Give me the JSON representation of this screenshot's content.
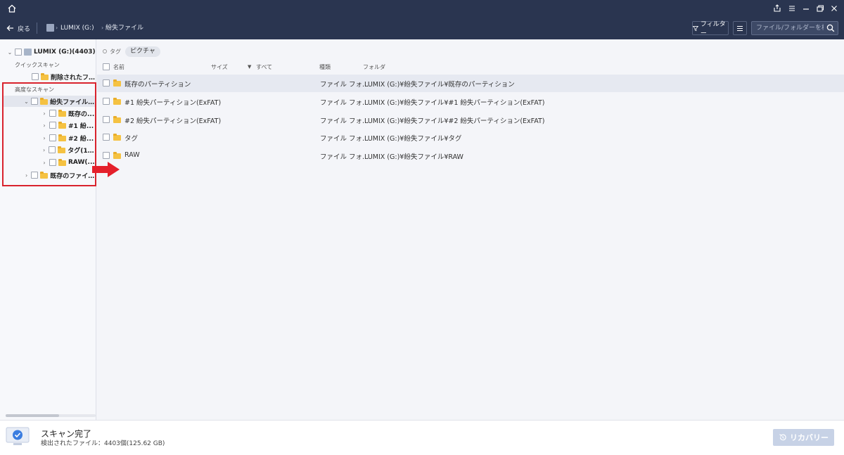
{
  "nav": {
    "back_label": "戻る",
    "crumbs": [
      "LUMIX (G:)",
      "紛失ファイル"
    ],
    "filter_label": "フィルター",
    "search_placeholder": "ファイル/フォルダーを検索"
  },
  "sidebar": {
    "root_label": "LUMIX (G:)(4403)",
    "quick_scan_label": "クイックスキャン",
    "deleted_label": "削除されたファ...",
    "advanced_scan_label": "高度なスキャン",
    "lost_label": "紛失ファイル(4...",
    "children": [
      "既存の...",
      "#1 紛...",
      "#2 紛...",
      "タグ(14...",
      "RAW(..."
    ],
    "existing_label": "既存のファイル..."
  },
  "main": {
    "tag_label": "タグ",
    "tag_chip": "ピクチャ",
    "columns": {
      "name": "名前",
      "size": "サイズ",
      "all": "すべて",
      "type": "種類",
      "folder": "フォルダ"
    },
    "rows": [
      {
        "name": "既存のパーティション",
        "type": "ファイル フォ...",
        "folder": "LUMIX (G:)¥紛失ファイル¥既存のパーティション"
      },
      {
        "name": "#1 紛失パーティション(ExFAT)",
        "type": "ファイル フォ...",
        "folder": "LUMIX (G:)¥紛失ファイル¥#1 紛失パーティション(ExFAT)"
      },
      {
        "name": "#2 紛失パーティション(ExFAT)",
        "type": "ファイル フォ...",
        "folder": "LUMIX (G:)¥紛失ファイル¥#2 紛失パーティション(ExFAT)"
      },
      {
        "name": "タグ",
        "type": "ファイル フォ...",
        "folder": "LUMIX (G:)¥紛失ファイル¥タグ"
      },
      {
        "name": "RAW",
        "type": "ファイル フォ...",
        "folder": "LUMIX (G:)¥紛失ファイル¥RAW"
      }
    ]
  },
  "status": {
    "title": "スキャン完了",
    "subtitle": "検出されたファイル：4403個(125.62 GB)",
    "recover_label": "リカバリー"
  },
  "colors": {
    "titlebar": "#2a3550",
    "folder": "#f5c242",
    "highlight": "#d9232d",
    "recover": "#c7d2e6"
  }
}
